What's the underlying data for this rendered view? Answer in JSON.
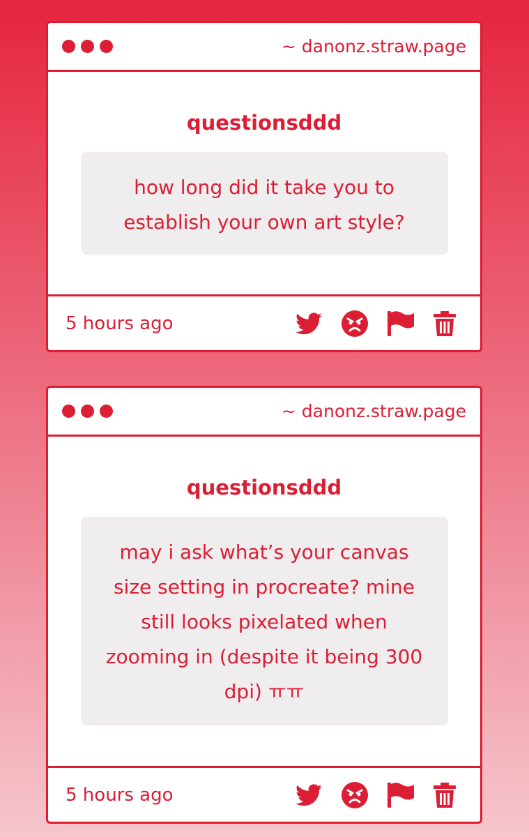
{
  "posts": [
    {
      "url": "~ danonz.straw.page",
      "sender": "questionsddd",
      "question": "how long did it take you to establish your own art style?",
      "timestamp": "5 hours ago",
      "actions": [
        "twitter-icon",
        "angry-face-icon",
        "flag-icon",
        "trash-icon"
      ]
    },
    {
      "url": "~ danonz.straw.page",
      "sender": "questionsddd",
      "question": "may i ask what’s your canvas size setting in procreate? mine still looks pixelated when zooming in (despite it being 300 dpi) ㅠㅠ",
      "timestamp": "5 hours ago",
      "actions": [
        "twitter-icon",
        "angry-face-icon",
        "flag-icon",
        "trash-icon"
      ]
    }
  ],
  "colors": {
    "accent": "#dc1e35",
    "bubble": "#efedee",
    "background_top": "#e5253f",
    "background_bottom": "#f6c6cd"
  }
}
